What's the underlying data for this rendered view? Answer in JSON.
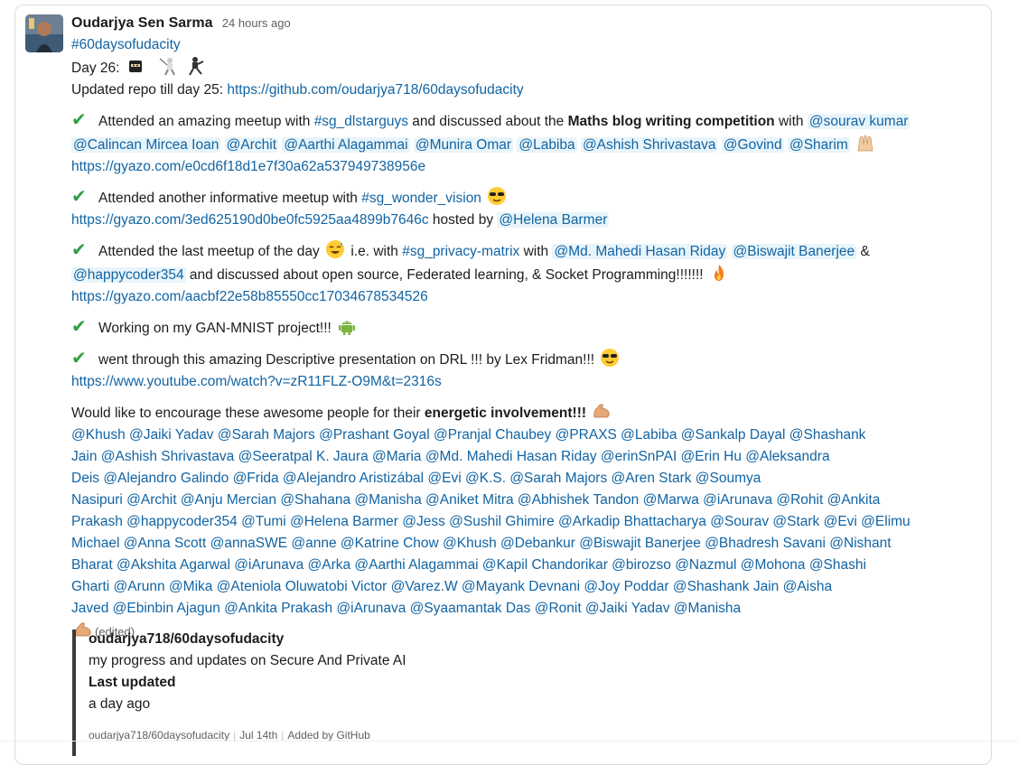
{
  "message": {
    "author": "Oudarjya Sen Sarma",
    "time": "24 hours ago",
    "channel_tag": "#60daysofudacity",
    "day_label": "Day 26:",
    "repo_prefix": "Updated repo till day 25: ",
    "repo_link": "https://github.com/oudarjya718/60daysofudacity",
    "p1": {
      "t1": "Attended an amazing meetup with ",
      "channel": "#sg_dlstarguys",
      "t2": "  and discussed about the ",
      "bold": "Maths blog writing competition",
      "t3": "  with ",
      "mentions": [
        "@sourav kumar",
        "@Calincan Mircea Ioan",
        "@Archit",
        "@Aarthi Alagammai",
        "@Munira Omar",
        "@Labiba",
        "@Ashish Shrivastava",
        "@Govind",
        "@Sharim"
      ],
      "link": "https://gyazo.com/e0cd6f18d1e7f30a62a537949738956e"
    },
    "p2": {
      "t1": "Attended another informative meetup with ",
      "channel": "#sg_wonder_vision",
      "link": "https://gyazo.com/3ed625190d0be0fc5925aa4899b7646c",
      "t2": " hosted by ",
      "mention": "@Helena Barmer"
    },
    "p3": {
      "t1": "Attended the last meetup of the day ",
      "t2": "  i.e. with ",
      "channel": "#sg_privacy-matrix",
      "t3": "  with ",
      "m1": "@Md. Mahedi Hasan Riday",
      "m2": "@Biswajit Banerjee",
      "amp": " & ",
      "m3": "@happycoder354",
      "t4": " and discussed about open source, Federated learning, & Socket Programming!!!!!!! ",
      "link": "https://gyazo.com/aacbf22e58b85550cc17034678534526"
    },
    "p4": {
      "t1": "Working on my GAN-MNIST project!!! "
    },
    "p5": {
      "t1": "went through this amazing Descriptive presentation on DRL !!! by Lex Fridman!!! ",
      "link": "https://www.youtube.com/watch?v=zR11FLZ-O9M&t=2316s"
    },
    "p6": {
      "t1": "Would like to encourage these awesome people for their ",
      "bold": "energetic involvement!!!",
      "mention_lines": [
        "@Khush  @Jaiki Yadav  @Sarah Majors  @Prashant Goyal @Pranjal Chaubey @PRAXS @Labiba @Sankalp Dayal  @Shashank",
        "Jain @Ashish Shrivastava @Seeratpal K. Jaura  @Maria @Md. Mahedi Hasan Riday @erinSnPAI  @Erin Hu  @Aleksandra",
        "Deis @Alejandro Galindo  @Frida @Alejandro Aristizábal  @Evi  @K.S.  @Sarah Majors  @Aren Stark @Soumya",
        "Nasipuri @Archit @Anju Mercian @Shahana @Manisha  @Aniket Mitra  @Abhishek Tandon  @Marwa @iArunava @Rohit @Ankita",
        "Prakash  @happycoder354 @Tumi @Helena Barmer  @Jess  @Sushil Ghimire @Arkadip Bhattacharya  @Sourav  @Stark  @Evi @Elimu",
        "Michael @Anna Scott @annaSWE @anne @Katrine Chow @Khush  @Debankur  @Biswajit Banerjee @Bhadresh Savani @Nishant",
        "Bharat  @Akshita Agarwal @iArunava @Arka @Aarthi Alagammai @Kapil Chandorikar @birozso  @Nazmul @Mohona @Shashi",
        "Gharti @Arunn @Mika @Ateniola Oluwatobi Victor @Varez.W @Mayank Devnani @Joy Poddar  @Shashank Jain  @Aisha",
        "Javed @Ebinbin Ajagun   @Ankita Prakash  @iArunava  @Syaamantak Das  @Ronit  @Jaiki Yadav  @Manisha"
      ],
      "edited": "(edited)"
    }
  },
  "attachment": {
    "title": "oudarjya718/60daysofudacity",
    "description": "my progress and updates on Secure And Private AI",
    "field_title": "Last updated",
    "field_value": "a day ago",
    "footer_repo": "oudarjya718/60daysofudacity",
    "footer_date": "Jul 14th",
    "footer_added": "Added by GitHub"
  },
  "icons": {
    "check": "heavy-check-mark-icon",
    "raised_hands": "raised-hands-icon",
    "sunglasses": "sunglasses-face-icon",
    "sweat_smile": "sweat-smile-face-icon",
    "fire": "fire-icon",
    "android": "android-icon",
    "flexed_biceps": "flexed-biceps-icon"
  },
  "colors": {
    "link": "#1264a3",
    "mention_bg": "#e8f5fa",
    "check": "#2f9e44"
  }
}
